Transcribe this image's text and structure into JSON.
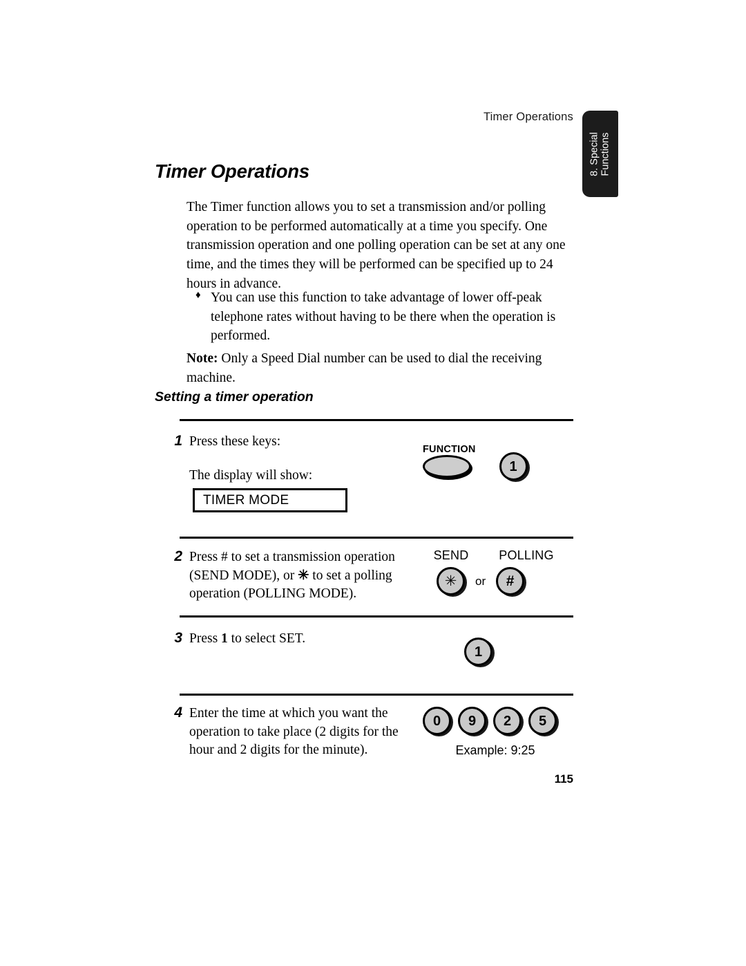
{
  "header": {
    "running_head": "Timer Operations"
  },
  "thumb_tab": {
    "line1": "8. Special",
    "line2": "Functions"
  },
  "title": "Timer Operations",
  "intro": "The Timer function allows you to set a transmission and/or polling operation to be performed automatically at a time you specify. One transmission operation and one polling operation can be set at any one time, and the times they will be performed can be specified up to 24 hours in advance.",
  "bullet": {
    "glyph": "♦",
    "text": "You can use this function to take advantage of lower off-peak telephone rates without having to be there when the operation is performed."
  },
  "note": {
    "label": "Note:",
    "text": " Only a Speed Dial number can be used to dial the receiving machine."
  },
  "sub_heading": "Setting a timer operation",
  "steps": [
    {
      "number": "1",
      "line1": "Press these keys:",
      "line2": "The display will show:",
      "display_text": "TIMER MODE",
      "keys": {
        "function_label": "FUNCTION",
        "digit": "1"
      }
    },
    {
      "number": "2",
      "text_a": "Press # to set a transmission operation (SEND MODE), or ",
      "symbol": "✳",
      "text_b": " to set a polling operation (POLLING MODE).",
      "keys": {
        "send_label": "SEND",
        "polling_label": "POLLING",
        "send_key": "✳",
        "polling_key": "#",
        "conjunction": "or"
      }
    },
    {
      "number": "3",
      "text_a": "Press ",
      "emphasis": "1",
      "text_b": " to select SET.",
      "keys": {
        "digit": "1"
      }
    },
    {
      "number": "4",
      "text": "Enter the time at which you want the operation to take place (2 digits for the hour and 2 digits for the minute).",
      "keys": {
        "digits": [
          "0",
          "9",
          "2",
          "5"
        ],
        "caption": "Example: 9:25"
      }
    }
  ],
  "folio": "115"
}
